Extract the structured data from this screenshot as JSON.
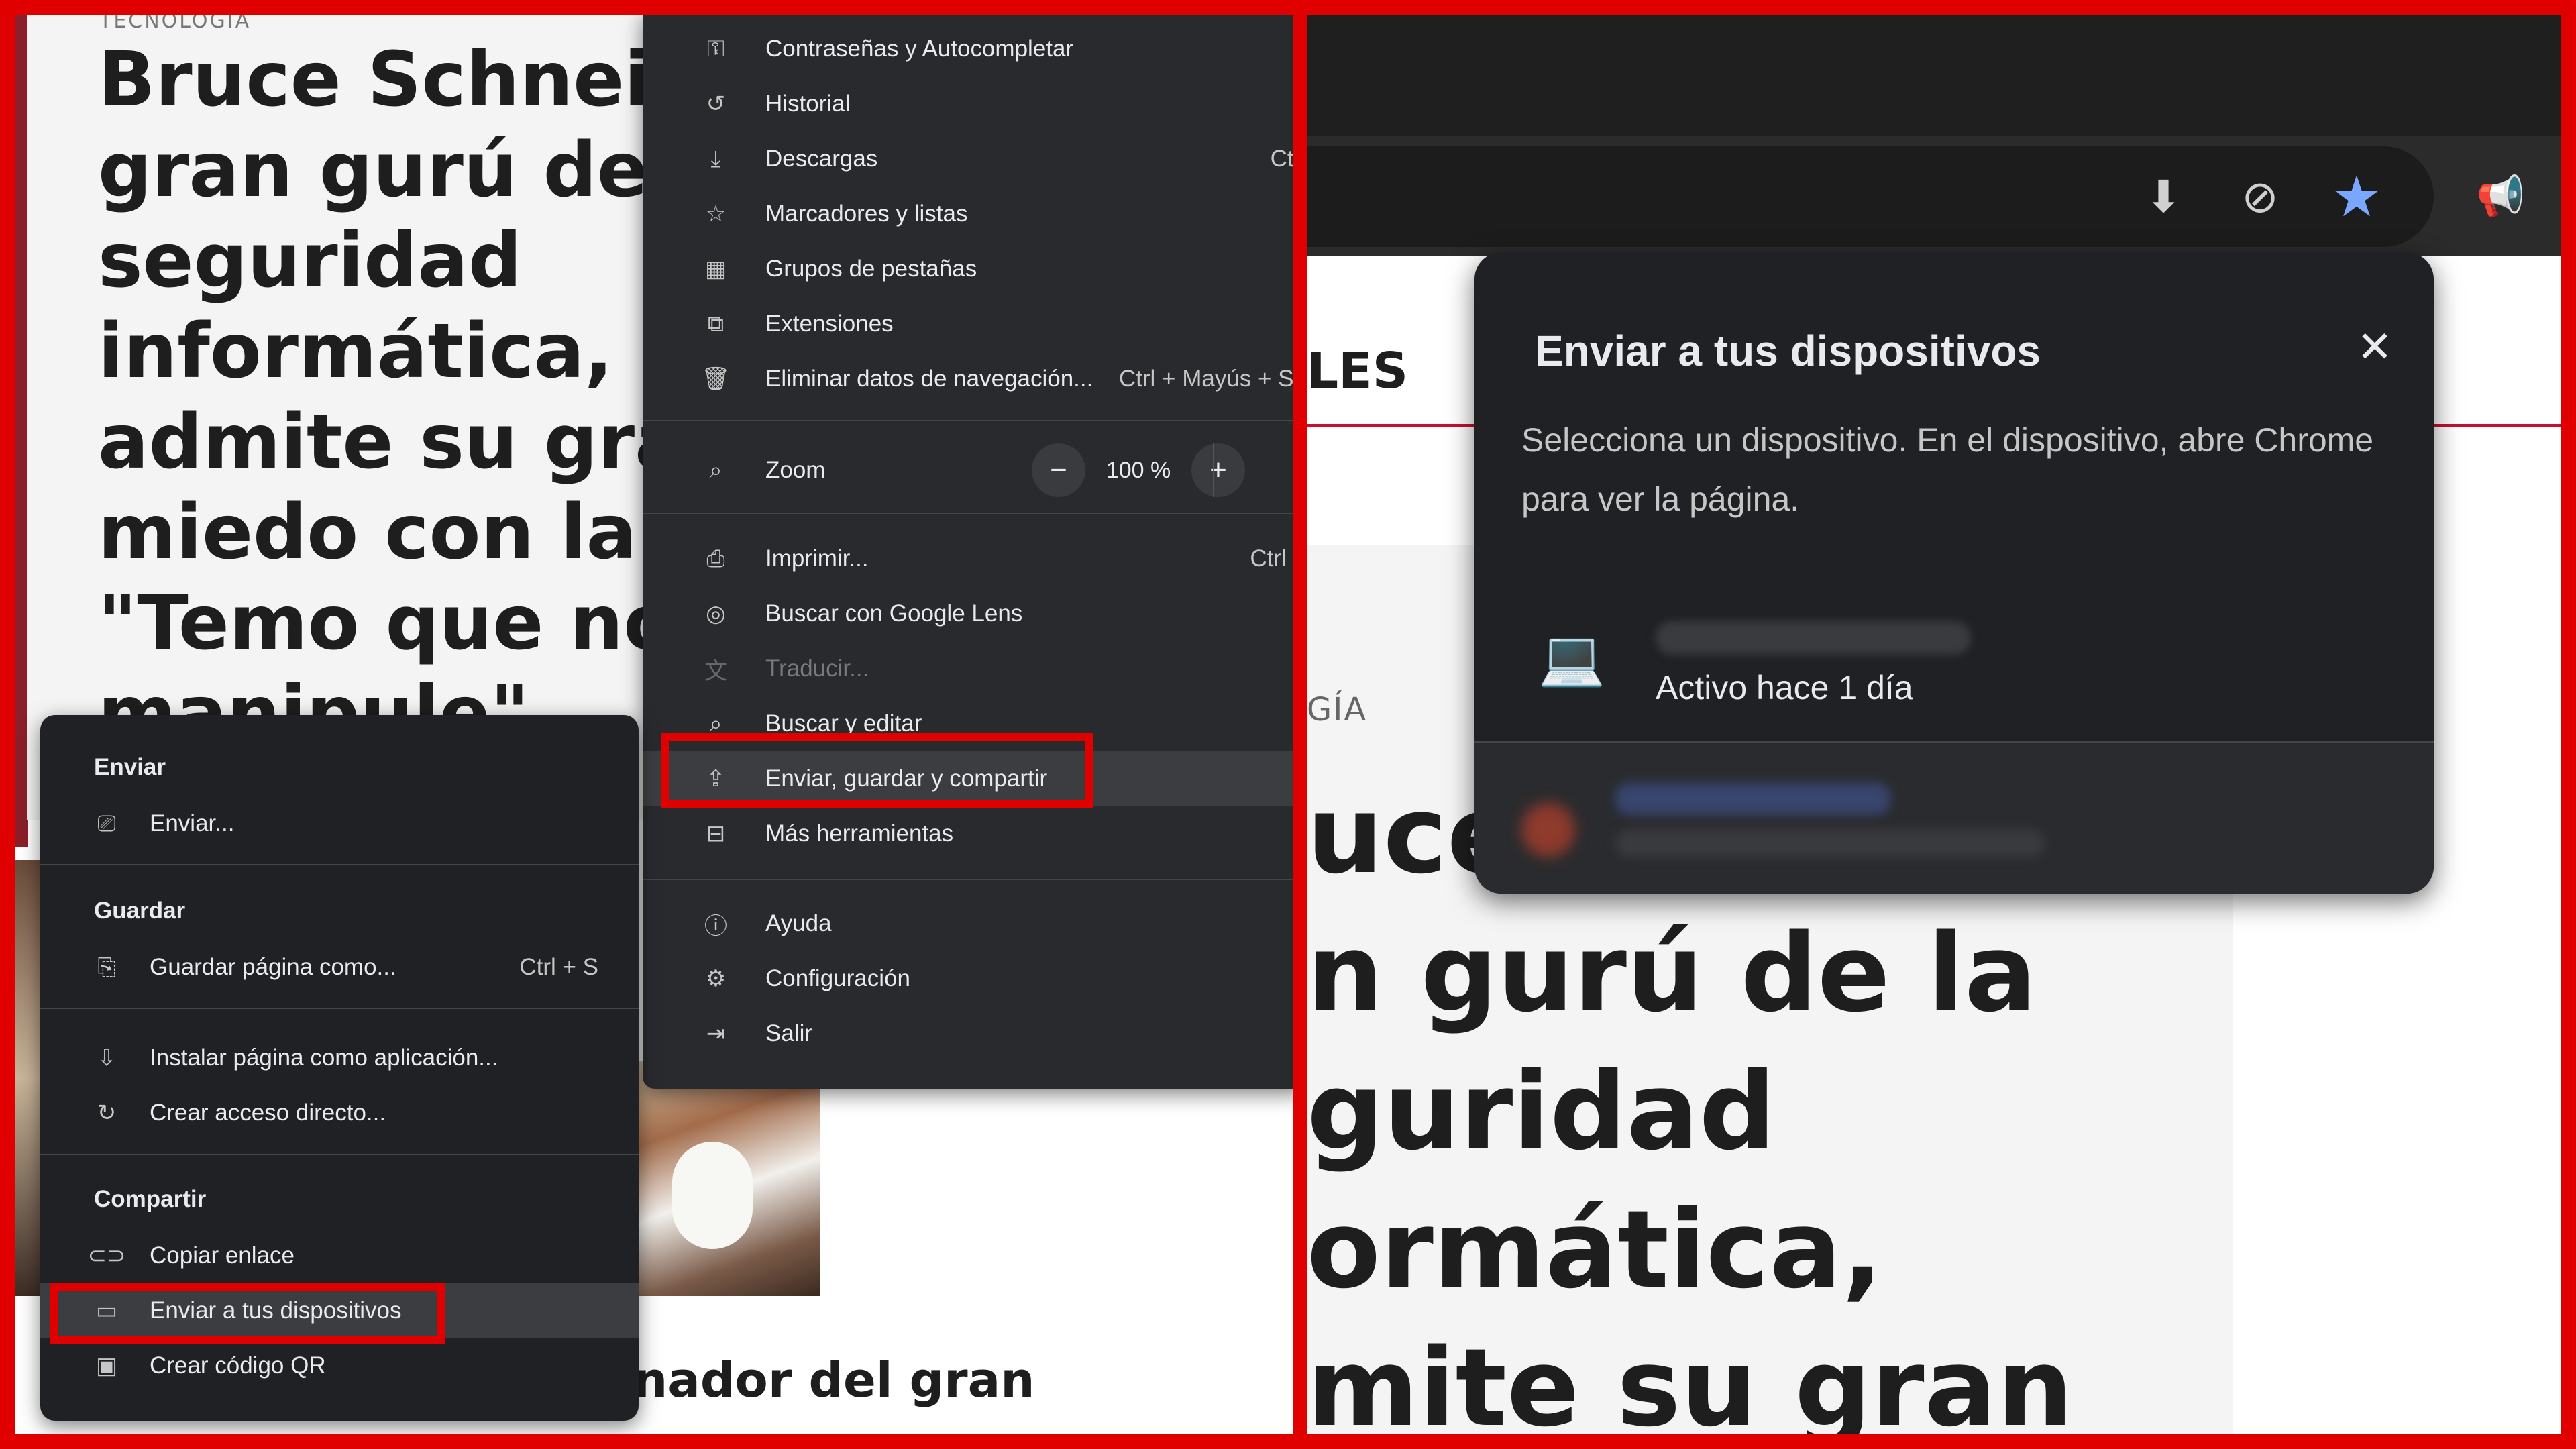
{
  "left_article": {
    "category": "TECNOLOGÍA",
    "headline_lines": [
      "Bruce Schneier,",
      "gran gurú de la",
      "seguridad",
      "informática,",
      "admite su gran",
      "miedo con la IA:",
      "\"Temo que nos",
      "manipule\""
    ],
    "teaser": "en el inesperado ganador del gran"
  },
  "main_menu": {
    "items": [
      {
        "label": "Contraseñas y Autocompletar",
        "icon": "key-icon"
      },
      {
        "label": "Historial",
        "icon": "history-icon"
      },
      {
        "label": "Descargas",
        "icon": "download-icon",
        "shortcut": "Ctrl"
      },
      {
        "label": "Marcadores y listas",
        "icon": "star-icon"
      },
      {
        "label": "Grupos de pestañas",
        "icon": "tab-groups-icon"
      },
      {
        "label": "Extensiones",
        "icon": "extension-icon"
      },
      {
        "label": "Eliminar datos de navegación...",
        "icon": "trash-icon",
        "shortcut": "Ctrl + Mayús + Su"
      }
    ],
    "zoom": {
      "label": "Zoom",
      "value": "100 %",
      "minus": "−",
      "plus": "+"
    },
    "items2": [
      {
        "label": "Imprimir...",
        "icon": "print-icon",
        "shortcut": "Ctrl +"
      },
      {
        "label": "Buscar con Google Lens",
        "icon": "lens-icon"
      },
      {
        "label": "Traducir...",
        "icon": "translate-icon"
      },
      {
        "label": "Buscar y editar",
        "icon": "find-icon"
      },
      {
        "label": "Enviar, guardar y compartir",
        "icon": "share-icon"
      },
      {
        "label": "Más herramientas",
        "icon": "toolbox-icon"
      }
    ],
    "items3": [
      {
        "label": "Ayuda",
        "icon": "help-icon"
      },
      {
        "label": "Configuración",
        "icon": "settings-icon"
      },
      {
        "label": "Salir",
        "icon": "exit-icon"
      }
    ]
  },
  "submenu": {
    "send_header": "Enviar",
    "send_item": "Enviar...",
    "save_header": "Guardar",
    "save_page": "Guardar página como...",
    "save_shortcut": "Ctrl + S",
    "install_app": "Instalar página como aplicación...",
    "create_shortcut": "Crear acceso directo...",
    "share_header": "Compartir",
    "copy_link": "Copiar enlace",
    "send_to_devices": "Enviar a tus dispositivos",
    "qr_code": "Crear código QR"
  },
  "right_page": {
    "nav_fragment": "LES",
    "category_fragment": "GÍA",
    "headline_lines": [
      "uce",
      "n gurú de la",
      "guridad",
      "ormática,",
      "mite su gran"
    ]
  },
  "dialog": {
    "title": "Enviar a tus dispositivos",
    "description": "Selecciona un dispositivo. En el dispositivo, abre Chrome para ver la página.",
    "device_status": "Activo hace 1 día"
  },
  "colors": {
    "highlight_border": "#e00000",
    "menu_bg": "#292a2d",
    "submenu_bg": "#202124",
    "bookmark_star": "#7aa7ff"
  }
}
